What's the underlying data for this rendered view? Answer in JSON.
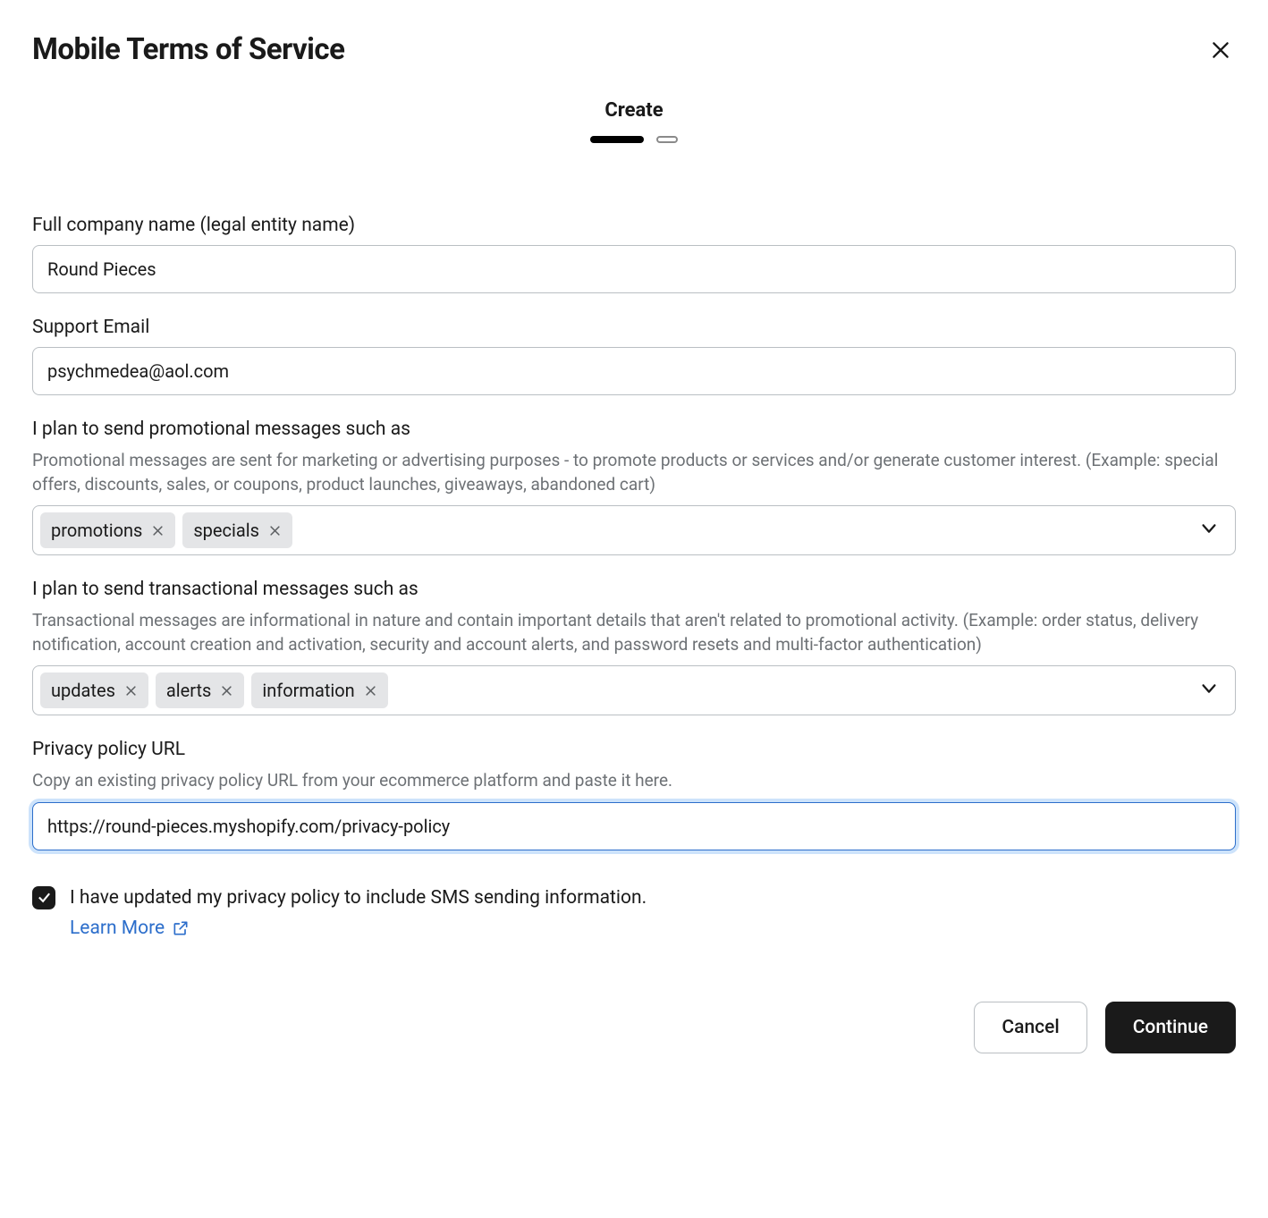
{
  "title": "Mobile Terms of Service",
  "step_label": "Create",
  "fields": {
    "company": {
      "label": "Full company name (legal entity name)",
      "value": "Round Pieces"
    },
    "email": {
      "label": "Support Email",
      "value": "psychmedea@aol.com"
    },
    "promotional": {
      "label": "I plan to send promotional messages such as",
      "helper": "Promotional messages are sent for marketing or advertising purposes - to promote products or services and/or generate customer interest. (Example: special offers, discounts, sales, or coupons, product launches, giveaways, abandoned cart)",
      "tags": [
        "promotions",
        "specials"
      ]
    },
    "transactional": {
      "label": "I plan to send transactional messages such as",
      "helper": "Transactional messages are informational in nature and contain important details that aren't related to promotional activity. (Example: order status, delivery notification, account creation and activation, security and account alerts, and password resets and multi-factor authentication)",
      "tags": [
        "updates",
        "alerts",
        "information"
      ]
    },
    "privacy_url": {
      "label": "Privacy policy URL",
      "helper": "Copy an existing privacy policy URL from your ecommerce platform and paste it here.",
      "value": "https://round-pieces.myshopify.com/privacy-policy"
    },
    "consent": {
      "label": "I have updated my privacy policy to include SMS sending information.",
      "learn_more": "Learn More"
    }
  },
  "buttons": {
    "cancel": "Cancel",
    "continue": "Continue"
  }
}
